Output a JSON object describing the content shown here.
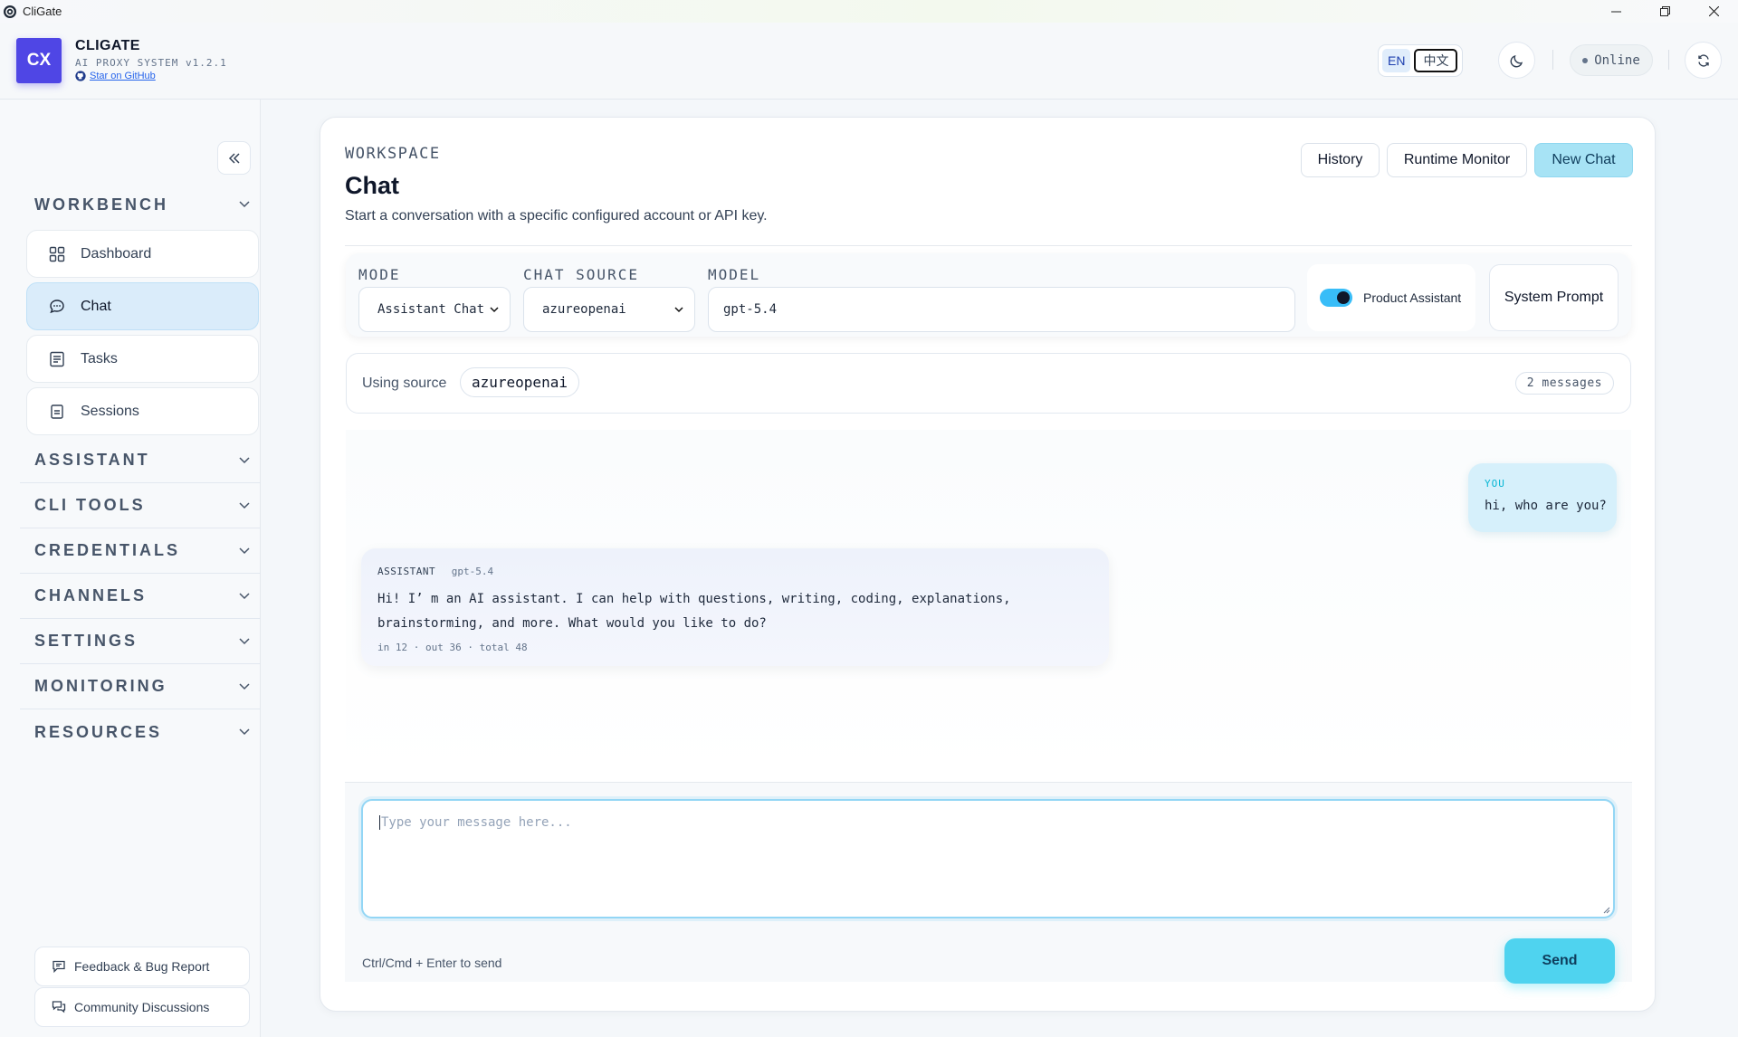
{
  "window": {
    "title": "CliGate"
  },
  "header": {
    "logo_text": "CX",
    "brand": "CLIGATE",
    "subtitle": "AI PROXY SYSTEM v1.2.1",
    "github_link": "Star on GitHub",
    "lang_en": "EN",
    "lang_zh": "中文",
    "status": "Online"
  },
  "sidebar": {
    "sections": {
      "workbench": "WORKBENCH",
      "assistant": "ASSISTANT",
      "cli_tools": "CLI TOOLS",
      "credentials": "CREDENTIALS",
      "channels": "CHANNELS",
      "settings": "SETTINGS",
      "monitoring": "MONITORING",
      "resources": "RESOURCES"
    },
    "items": {
      "dashboard": "Dashboard",
      "chat": "Chat",
      "tasks": "Tasks",
      "sessions": "Sessions"
    },
    "footer": {
      "feedback": "Feedback & Bug Report",
      "community": "Community Discussions"
    }
  },
  "page": {
    "eyebrow": "WORKSPACE",
    "title": "Chat",
    "description": "Start a conversation with a specific configured account or API key.",
    "buttons": {
      "history": "History",
      "runtime_monitor": "Runtime Monitor",
      "new_chat": "New Chat"
    }
  },
  "config": {
    "mode_label": "MODE",
    "mode_value": "Assistant Chat",
    "source_label": "CHAT SOURCE",
    "source_value": "azureopenai",
    "model_label": "MODEL",
    "model_value": "gpt-5.4",
    "product_assistant_label": "Product Assistant",
    "product_assistant_on": true,
    "system_prompt_button": "System Prompt"
  },
  "source_bar": {
    "using_label": "Using source",
    "source": "azureopenai",
    "message_count": "2 messages"
  },
  "messages": [
    {
      "role_label": "YOU",
      "text": "hi, who are you?"
    },
    {
      "role_label": "ASSISTANT",
      "model": "gpt-5.4",
      "text": "Hi! I’ m an AI assistant. I can help with questions, writing, coding, explanations, brainstorming, and more. What would you like to do?",
      "tokens": "in 12 · out 36 · total 48"
    }
  ],
  "composer": {
    "placeholder": "Type your message here...",
    "hint": "Ctrl/Cmd + Enter to send",
    "send_label": "Send"
  },
  "colors": {
    "brand": "#4f46e5",
    "accent": "#4fd3ef",
    "active_nav": "#daecfa"
  }
}
